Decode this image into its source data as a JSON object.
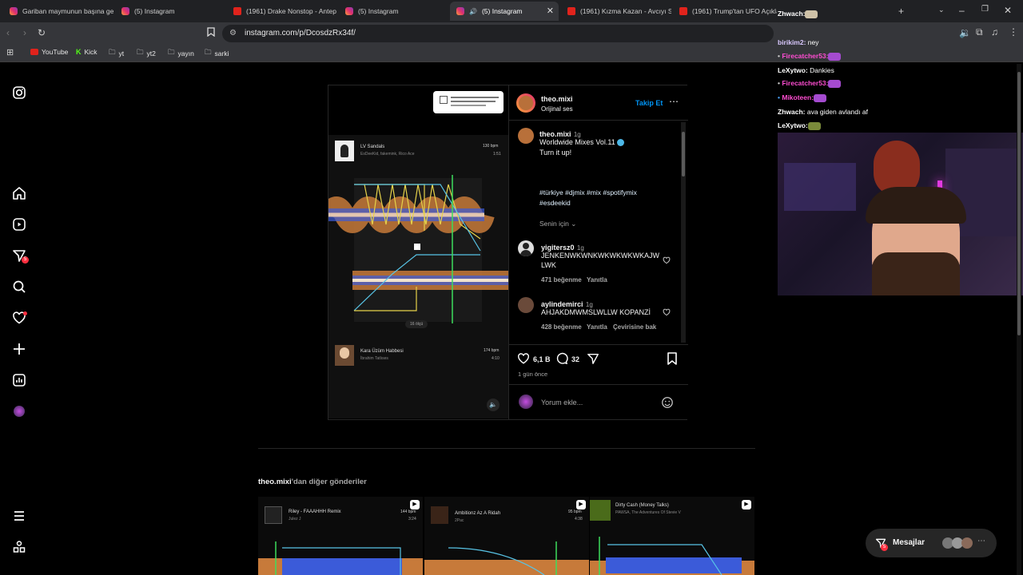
{
  "browser": {
    "tabs": [
      {
        "label": "Gariban maymunun başına ge",
        "icon": "instagram-icon",
        "kind": "ig"
      },
      {
        "label": "(5) Instagram",
        "icon": "instagram-icon",
        "kind": "ig"
      },
      {
        "label": "(1961) Drake Nonstop - Antep",
        "icon": "youtube-icon",
        "kind": "yt"
      },
      {
        "label": "(5) Instagram",
        "icon": "instagram-icon",
        "kind": "ig"
      },
      {
        "label": "(5) Instagram",
        "icon": "instagram-icon",
        "kind": "ig",
        "active": true
      },
      {
        "label": "(1961) Kızma Kazan - Avcıyı Si",
        "icon": "youtube-icon",
        "kind": "yt"
      },
      {
        "label": "(1961) Trump'tan UFO Açıklam",
        "icon": "youtube-icon",
        "kind": "yt"
      }
    ],
    "url": "instagram.com/p/DcosdzRx34f/",
    "bookmarks": [
      {
        "label": "YouTube",
        "icon": "youtube-icon"
      },
      {
        "label": "Kick",
        "icon": "kick-icon"
      },
      {
        "label": "yt",
        "icon": "folder-icon"
      },
      {
        "label": "yt2",
        "icon": "folder-icon"
      },
      {
        "label": "yayın",
        "icon": "folder-icon"
      },
      {
        "label": "sarki",
        "icon": "folder-icon"
      }
    ]
  },
  "nav": {
    "notification_count": "5",
    "messages_label": "Mesajlar",
    "messages_count": "5"
  },
  "post": {
    "username": "theo.mixi",
    "audio": "Orijinal ses",
    "follow_label": "Takip Et",
    "caption": {
      "username": "theo.mixi",
      "time": "1g",
      "line1": "Worldwide Mixes Vol.11",
      "line2": "Turn it up!",
      "hashtags": "#türkiye #djmix #mix #spotifymix",
      "hashtags2": "#esdeekid"
    },
    "for_you_label": "Senin için",
    "comments": [
      {
        "username": "yigitersz0",
        "time": "1g",
        "text": "JENKENWKWNKWKWKWKWKAJW LWK",
        "likes": "471 beğenme",
        "reply": "Yanıtla"
      },
      {
        "username": "aylindemirci",
        "time": "1g",
        "text": "AHJAKDMWMSLWLLW KOPANZİ",
        "likes": "428 beğenme",
        "reply": "Yanıtla",
        "translate": "Çevirisine bak"
      }
    ],
    "like_count": "6,1 B",
    "comment_count": "32",
    "posted": "1 gün önce",
    "comment_placeholder": "Yorum ekle...",
    "media": {
      "track1_title": "LV Sandals",
      "track1_artist": "EsDeeKid, fakemink, Rico Ace",
      "track1_bpm": "130 bpm",
      "track1_time": "1:51",
      "track2_title": "Kara Üzüm Habbesi",
      "track2_artist": "İbrahim Tatlıses",
      "track2_bpm": "174 bpm",
      "track2_time": "4:10",
      "beats_label": "16 ölçü"
    }
  },
  "more_posts": {
    "username": "theo.mixi",
    "suffix": "'dan diğer gönderiler",
    "items": [
      {
        "title": "Riley - FAAAHHH Remix",
        "artist": "Julez J",
        "bpm": "144 bpm",
        "time": "3:24"
      },
      {
        "title": "Ambitionz Az A Ridah",
        "artist": "2Pac",
        "bpm": "95 bpm",
        "time": "4:38"
      },
      {
        "title": "Dirty Cash (Money Talks)",
        "artist": "PAWSA, The Adventures Of Stevie V",
        "bpm": "",
        "time": ""
      }
    ]
  },
  "chat": [
    {
      "user": "Zhwach:",
      "msg": "",
      "color": "#ffffff"
    },
    {
      "user": "birikim2:",
      "msg": " ney",
      "color": "#d9c8ff"
    },
    {
      "user": "Firecatcher53:",
      "msg": "",
      "color": "#ff4dd2"
    },
    {
      "user": "LeXytwo:",
      "msg": " Dankies",
      "color": "#ffffff"
    },
    {
      "user": "Firecatcher53:",
      "msg": "",
      "color": "#ff4dd2"
    },
    {
      "user": "Mikoteen:",
      "msg": "",
      "color": "#ff4dd2"
    },
    {
      "user": "Zhwach:",
      "msg": " ava giden avlandı af",
      "color": "#ffffff"
    },
    {
      "user": "LeXytwo:",
      "msg": "",
      "color": "#ffffff"
    }
  ],
  "colors": {
    "accent": "#0095f6",
    "link": "#e0f1ff",
    "badge": "#ff3040"
  }
}
